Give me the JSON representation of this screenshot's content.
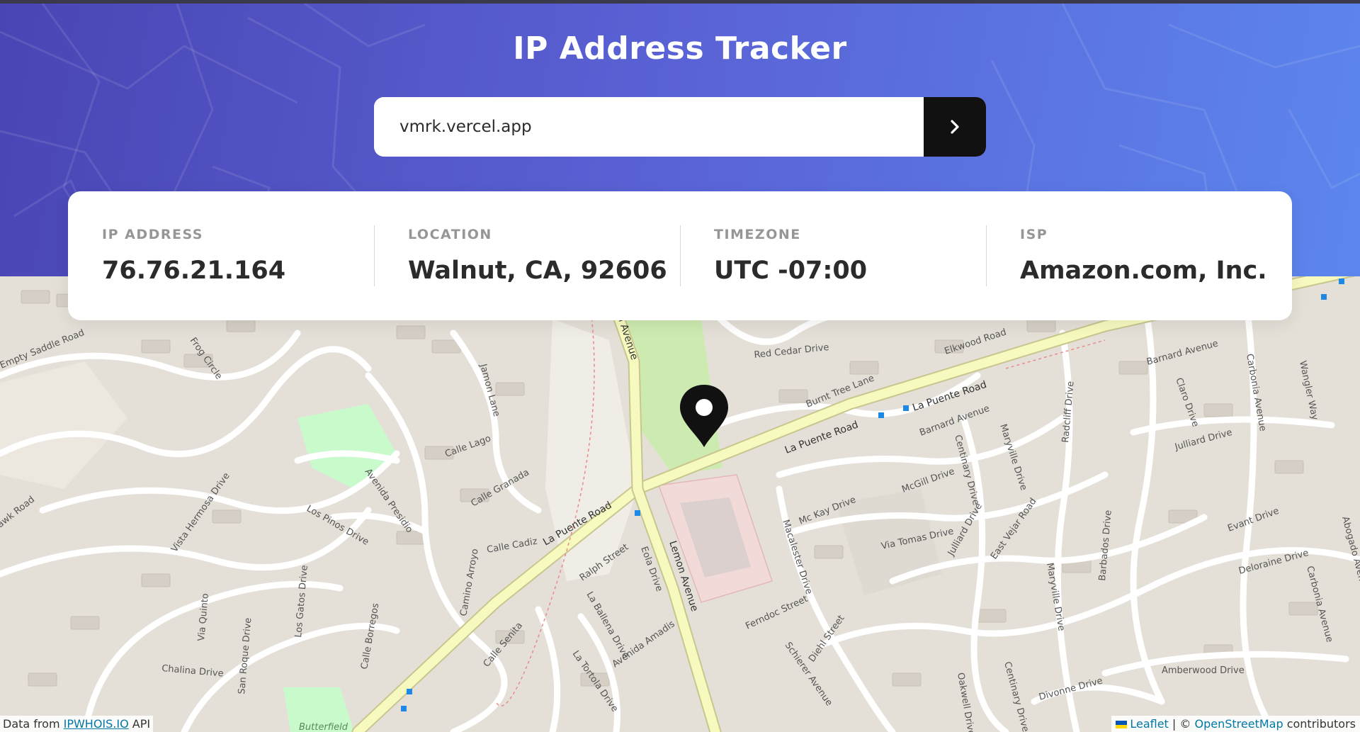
{
  "header": {
    "title": "IP Address Tracker"
  },
  "search": {
    "value": "vmrk.vercel.app",
    "submit_icon": "chevron-right-icon"
  },
  "info": {
    "ip_label": "IP ADDRESS",
    "ip_value": "76.76.21.164",
    "location_label": "LOCATION",
    "location_value": "Walnut, CA, 92606",
    "timezone_label": "TIMEZONE",
    "timezone_value": "UTC -07:00",
    "isp_label": "ISP",
    "isp_value": "Amazon.com, Inc."
  },
  "map": {
    "marker_icon": "location-pin-icon",
    "roads": {
      "la_puente": "La Puente Road",
      "lemon": "Lemon Avenue",
      "red_cedar": "Red Cedar Drive",
      "elkwood": "Elkwood Road",
      "burnt_tree": "Burnt Tree Lane",
      "barnard": "Barnard Avenue",
      "mckay": "Mc Kay Drive",
      "mcgill": "McGill Drive",
      "via_tomas": "Via Tomas Drive",
      "julliard": "Julliard Drive",
      "centinary": "Centinary Drive",
      "maryville": "Maryville Drive",
      "radcliff": "Radcliff Drive",
      "calle_lago": "Calle Lago",
      "calle_granada": "Calle Granada",
      "calle_cadiz": "Calle Cadiz",
      "los_pinos": "Los Pinos Drive",
      "avenida_presidio": "Avenida Presidio",
      "jamon": "Jamon Lane",
      "vista_hermosa": "Vista Hermosa Drive",
      "ralph": "Ralph Street",
      "eola": "Eola Drive",
      "la_ballena": "La Ballena Drive",
      "avenida_amadis": "Avenida Amadis",
      "calle_senita": "Calle Senita",
      "la_tortola": "La Tortola Drive",
      "camino_arroyo": "Camino Arroyo",
      "calle_borregos": "Calle Borregos",
      "los_gatos": "Los Gatos Drive",
      "san_roque": "San Roque Drive",
      "via_quinto": "Via Quinto",
      "chalina": "Chalina Drive",
      "macalester": "Macalester Drive",
      "ferndoc": "Ferndoc Street",
      "diehl": "Diehl Street",
      "schierer": "Schierer Avenue",
      "east_vejar": "East Vejar Road",
      "evant": "Evant Drive",
      "deloraine": "Deloraine Drive",
      "carbonia": "Carbonia Avenue",
      "amberwood": "Amberwood Drive",
      "divonne": "Divonne Drive",
      "oakwell": "Oakwell Drive",
      "barbados": "Barbados Drive",
      "wangler": "Wangler Way",
      "claro": "Claro Drive",
      "empty_saddle": "Empty Saddle Road",
      "frog_circle": "Frog Circle",
      "hawk": "awk Road",
      "abogado": "Abogado Aven",
      "butterfield": "Butterfield"
    }
  },
  "attribution": {
    "left_prefix": "Data from ",
    "left_link": "IPWHOIS.IO",
    "left_suffix": " API",
    "leaflet": "Leaflet",
    "separator": " | © ",
    "osm": "OpenStreetMap",
    "osm_suffix": " contributors"
  },
  "colors": {
    "header_start": "#4a45b4",
    "header_end": "#5c86ee",
    "button": "#111111",
    "major_road": "#f7fabf",
    "park": "#c8facc",
    "commercial": "#f2dad9"
  }
}
